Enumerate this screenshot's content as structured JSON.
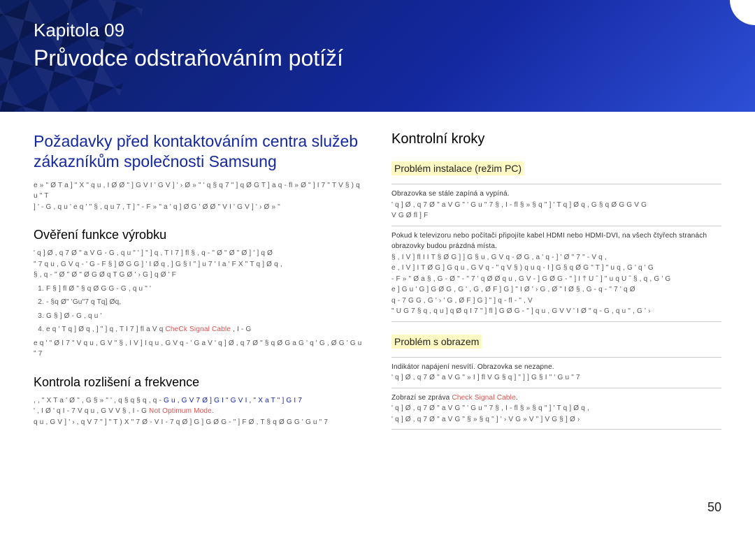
{
  "header": {
    "chapter_label": "Kapitola  09",
    "chapter_title": "Průvodce odstraňováním potíží"
  },
  "left": {
    "h2": "Požadavky před kontaktováním centra služeb zákazníkům společnosti Samsung",
    "intro_garbled": "e » \"   Ø   T a   ] \" X       \"   q u , I Ø   Ø \"   ] G   V I ' G V ]     ' ›     Ø » \"         ' q     § q 7 \"   ] q   Ø       G T     ]   a   q - fl » Ø \"   ] I   7 \"           T   V § )     q u \" T",
    "intro_garbled2": "]   '     - G , q u '       e q   '       \"   § , q u 7 , T   ] \" - F » \"     a   ' q ] Ø G ' Ø     Ø \"   V I ' G V ]     ' ›     Ø » \"",
    "h3a": "Ověření funkce výrobku",
    "p1": "' q ] Ø , q 7     Ø \" a   V   G   - G , q u \" '         ]       \"   ] q , T I 7 ] fl       § , q -   \"   Ø \"   Ø \"   Ø       ] '   ] q   Ø",
    "p2": "\"   7   q u , G V q -   '  G  - F §     ] Ø G   G       ]   ' I Ø q ,   ] G § I   \" ]       u 7   ' I a       '  F X     \"   T q ]   Ø q ,",
    "p3": "§ , q -   \"   Ø \"   Ø \"   Ø   G   Ø q T G Ø     ' ›       G   ] q   Ø   '  F",
    "ol": [
      "F § ] fl Ø \"   § q     Ø G     G   - G , q u \" '",
      "- §q  Ø\"  'Gu\"7 q Tq]  Øq,",
      "G § ]   Ø    - G , q u '",
      "e q   '       T q ]   Ø q ,       ]       \"   ] q , T I 7 ] fl a   V q"
    ],
    "ol4_warn": "CheCk Signal Cable",
    "ol4_tail": " , I - G",
    "p4": "e q   '       \"   Ø I 7 \"  V q u , G V       \"   § , I V   ] I   q u , G V q -   '  G  a   V ' q ] Ø , q 7     Ø \"   § q     Ø G   a       G       ' q     ' G , Ø     G   ' G u \" 7",
    "h3b": "Kontrola rozlišení a frekvence",
    "p5_a": ",  , \"  X   T   a   '  Ø \" , G   § » \" ' ,  q       § q   § q , q -",
    "p5_link": "G  u  ,  G  V  7    Ø   ]  G  I  \"  G   V     I     ,  \"  X   a T  \"    ] G I  7",
    "p6_a": "' ,  I Ø ' q       I  -   7     V  q u ,  G  V       V  §  , I - G   ",
    "p6_warn": "Not Optimum Mode",
    "p6_b": ".",
    "p7": "q u , G V ] ' ›     , q V 7   \"   ]       \"   T ) X \"   7       Ø   -   V I -     7 q   Ø     ] G   ] G   Ø G -   \" ]       F   Ø , T     § q     Ø G       G       ' G  u \" 7"
  },
  "right": {
    "h3": "Kontrolní kroky",
    "h4a": "Problém instalace (režim PC)",
    "row1_q": "Obrazovka se stále zapíná a vypíná.",
    "row1_a1": "' q ] Ø , q 7     Ø \" a   V   G       \"   ' G u \" 7     § , I - fl   § »   § q   \" ]   '   T q ]   Ø q ,     G   § q       Ø G       G   V   G",
    "row1_a2": "V   G       Ø fl  ]  F",
    "row2_q": "Pokud k televizoru nebo počítači připojíte kabel HDMI nebo HDMI-DVI, na všech čtyřech stranách obrazovky budou prázdná místa.",
    "row2_a1": "§ ,  I  V   ] fl   I  I  T        § Ø  G  ]  ] G   §  u ,  G  V  q    - Ø  G ,   a        '   q   -               ] '       Ø \" 7 \" -   V q ,",
    "row2_a2": "e , I V   ] I   T     Ø G   ] G   q u , G V q -       \"         q   V § )   q u q - I ] G   § q     Ø G   \" T   ] \" u q     , G     ' q   ' G",
    "row2_a3": "- F » \"       Ø a     § , G - Ø \"     - \" 7   ' q   Ø   Ø   q u , G V     -   ] G   Ø G -   \" ]     I   † U   ˆ   ] \" u q   U   ˆ   § , q     , G     '  G",
    "row2_a4": "e     ] G u       ' G   ] G   Ø G     , G       '   , G , Ø F   ] G   ] \"       I   Ø     ' › G , Ø     \"   I   Ø       § , G - q     - \" 7   ' q   Ø",
    "row2_a5": "q -  7 G   G         , G       ' ›     ' G , Ø F   ] G   ] \"   ]   q -  fl         -   \" ,  V",
    "row2_a6": "\"  U  G 7       § q   , q u ] q   Ø     q   I 7 \"   ]   fl   ] G   Ø G   -   \" ]       q u , G V       V   '  I Ø \"   q     - G , q u   \"       , G         ' ›",
    "h4b": "Problém s obrazem",
    "row3_q": "Indikátor napájení nesvítí. Obrazovka se nezapne.",
    "row3_a": "' q ] Ø , q 7     Ø \" a   V   G       \"   » I   ]   fl   V G § q   ] \"  ]  ] G § I   \"       ' G u \" 7",
    "row4_q_a": "Zobrazí se zpráva ",
    "row4_q_warn": "Check Signal Cable",
    "row4_q_b": ".",
    "row4_a1": "' q ] Ø , q 7     Ø \" a   V   G       \"   ' G u \" 7     § , I -  fl   § »   § q   \" ]   '   T q ]   Ø q ,",
    "row4_a2": "' q ] Ø , q 7     Ø \" a   V   G       \"   § »   § q   \" ]   ' ›   V G »   V \" ]     V G § ]   Ø ›"
  },
  "page_num": "50"
}
